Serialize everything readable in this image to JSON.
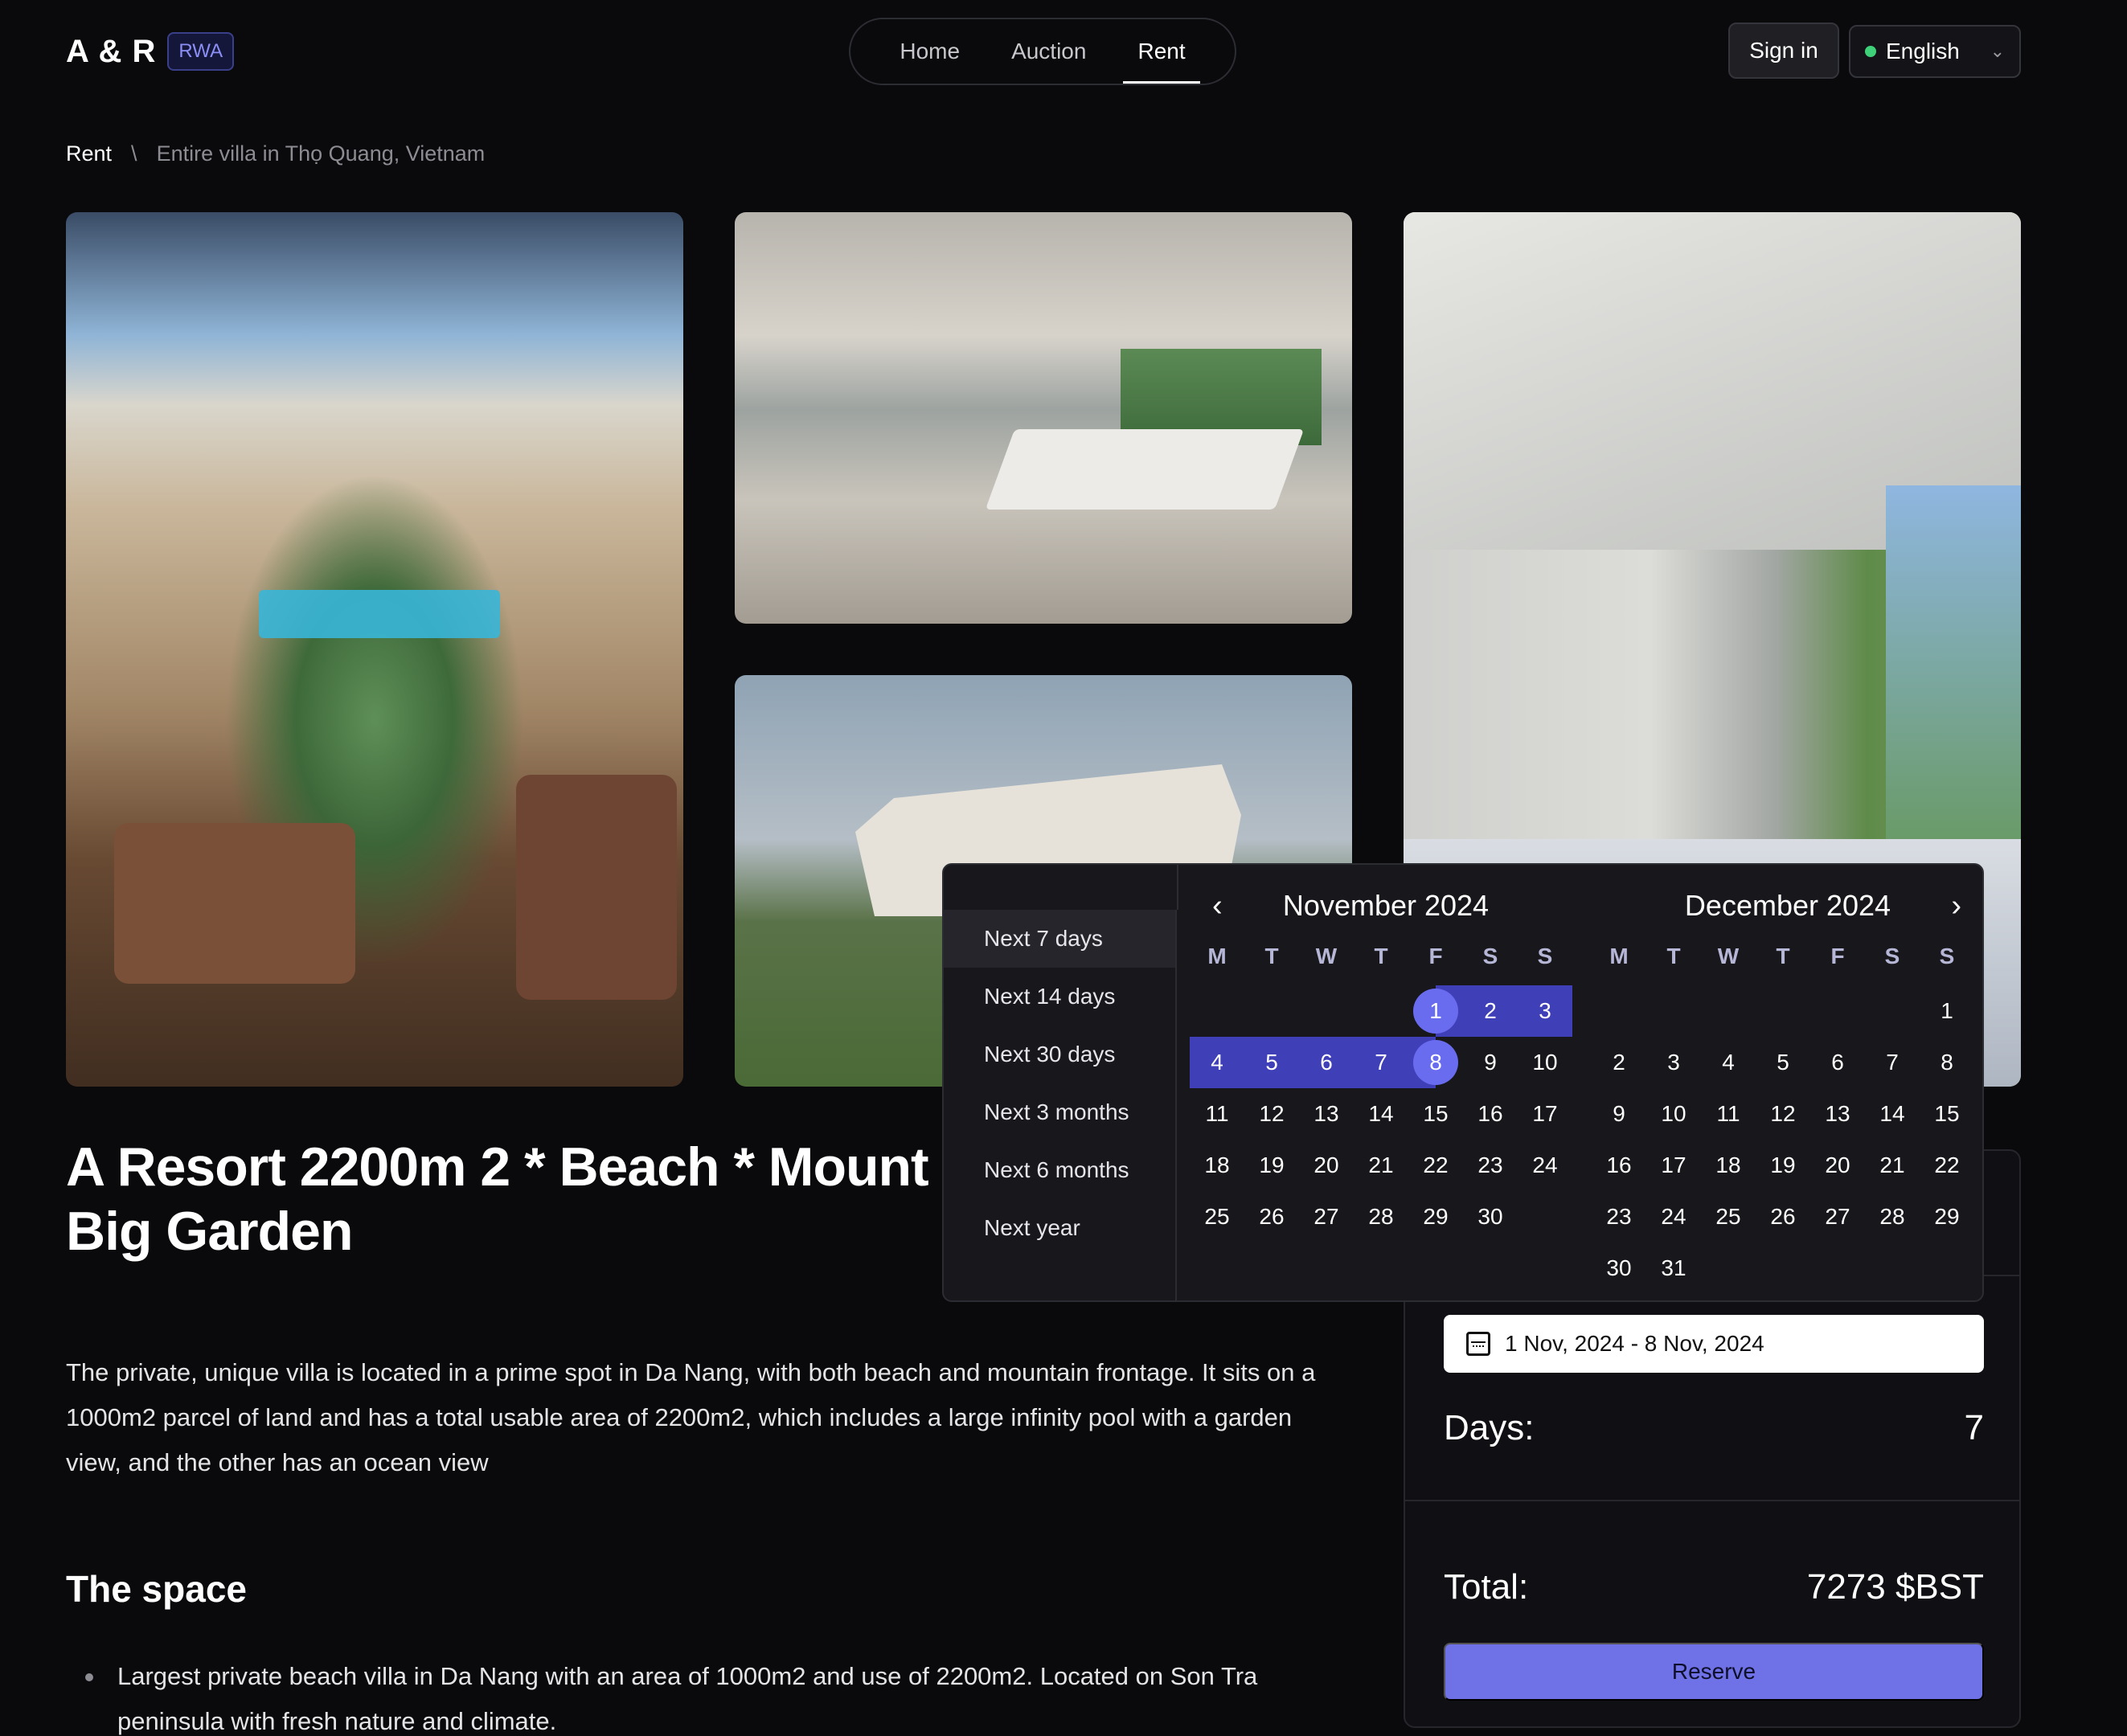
{
  "header": {
    "logo": "A & R",
    "badge": "RWA",
    "nav": [
      "Home",
      "Auction",
      "Rent"
    ],
    "signin": "Sign in",
    "language": "English"
  },
  "breadcrumb": {
    "root": "Rent",
    "separator": "\\",
    "current": "Entire villa in Thọ Quang, Vietnam"
  },
  "listing": {
    "title": "A Resort 2200m 2 * Beach * Mount Big Garden",
    "description": "The private, unique villa is located in a prime spot in Da Nang, with both beach and mountain frontage. It sits on a 1000m2 parcel of land and has a total usable area of 2200m2, which includes a large infinity pool with a garden view, and the other has an ocean view",
    "space_title": "The space",
    "space_bullet": "Largest private beach villa in Da Nang with an area of 1000m2 and use of 2200m2. Located on Son Tra peninsula with fresh nature and climate."
  },
  "booking": {
    "date_range": "1 Nov, 2024 - 8 Nov, 2024",
    "days_label": "Days:",
    "days_value": "7",
    "total_label": "Total:",
    "total_value": "7273 $BST",
    "reserve_label": "Reserve"
  },
  "picker": {
    "presets": [
      "Next 7 days",
      "Next 14 days",
      "Next 30 days",
      "Next 3 months",
      "Next 6 months",
      "Next year"
    ],
    "weekdays": [
      "M",
      "T",
      "W",
      "T",
      "F",
      "S",
      "S"
    ],
    "november": {
      "title": "November 2024",
      "offset": 4,
      "days": 30
    },
    "december": {
      "title": "December 2024",
      "offset": 6,
      "days": 31
    },
    "range_start": 1,
    "range_end": 8
  },
  "colors": {
    "accent": "#6a6cf0",
    "range": "#3f3fb8",
    "reserve": "#6f72e6"
  }
}
